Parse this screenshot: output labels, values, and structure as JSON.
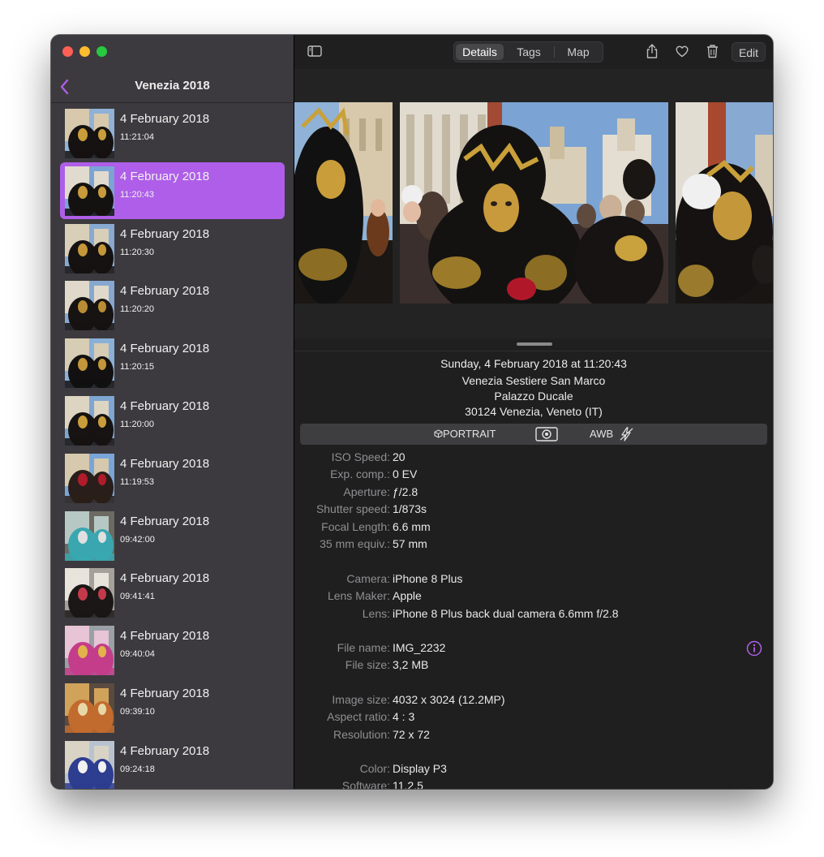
{
  "sidebar": {
    "title": "Venezia 2018",
    "items": [
      {
        "date": "4 February 2018",
        "time": "11:21:04",
        "selected": false
      },
      {
        "date": "4 February 2018",
        "time": "11:20:43",
        "selected": true
      },
      {
        "date": "4 February 2018",
        "time": "11:20:30",
        "selected": false
      },
      {
        "date": "4 February 2018",
        "time": "11:20:20",
        "selected": false
      },
      {
        "date": "4 February 2018",
        "time": "11:20:15",
        "selected": false
      },
      {
        "date": "4 February 2018",
        "time": "11:20:00",
        "selected": false
      },
      {
        "date": "4 February 2018",
        "time": "11:19:53",
        "selected": false
      },
      {
        "date": "4 February 2018",
        "time": "09:42:00",
        "selected": false
      },
      {
        "date": "4 February 2018",
        "time": "09:41:41",
        "selected": false
      },
      {
        "date": "4 February 2018",
        "time": "09:40:04",
        "selected": false
      },
      {
        "date": "4 February 2018",
        "time": "09:39:10",
        "selected": false
      },
      {
        "date": "4 February 2018",
        "time": "09:24:18",
        "selected": false
      }
    ]
  },
  "toolbar": {
    "tabs": [
      {
        "label": "Details",
        "active": true
      },
      {
        "label": "Tags",
        "active": false
      },
      {
        "label": "Map",
        "active": false
      }
    ],
    "edit_label": "Edit",
    "icons": [
      "sidebar-toggle-icon",
      "share-icon",
      "heart-icon",
      "trash-icon"
    ]
  },
  "details": {
    "datetime": "Sunday, 4 February 2018 at 11:20:43",
    "location": [
      "Venezia Sestiere San Marco",
      "Palazzo Ducale",
      "30124 Venezia, Veneto (IT)"
    ],
    "mode": "PORTRAIT",
    "wb": "AWB",
    "rows": [
      {
        "label": "ISO Speed:",
        "value": "20"
      },
      {
        "label": "Exp. comp.:",
        "value": "0 EV"
      },
      {
        "label": "Aperture:",
        "value": "ƒ/2.8"
      },
      {
        "label": "Shutter speed:",
        "value": "1/873s"
      },
      {
        "label": "Focal Length:",
        "value": "6.6 mm"
      },
      {
        "label": "35 mm equiv.:",
        "value": "57 mm"
      },
      {
        "label": "Camera:",
        "value": "iPhone 8 Plus"
      },
      {
        "label": "Lens Maker:",
        "value": "Apple"
      },
      {
        "label": "Lens:",
        "value": "iPhone 8 Plus back dual camera 6.6mm f/2.8"
      },
      {
        "label": "File name:",
        "value": "IMG_2232"
      },
      {
        "label": "File size:",
        "value": "3,2 MB"
      },
      {
        "label": "Image size:",
        "value": "4032 x 3024 (12.2MP)"
      },
      {
        "label": "Aspect ratio:",
        "value": "4 : 3"
      },
      {
        "label": "Resolution:",
        "value": "72 x 72"
      },
      {
        "label": "Color:",
        "value": "Display P3"
      },
      {
        "label": "Software:",
        "value": "11.2.5"
      }
    ]
  },
  "colors": {
    "accent": "#ae5ee8",
    "sidebar_bg": "#3c3a3e",
    "main_bg": "#1f1f1f"
  }
}
